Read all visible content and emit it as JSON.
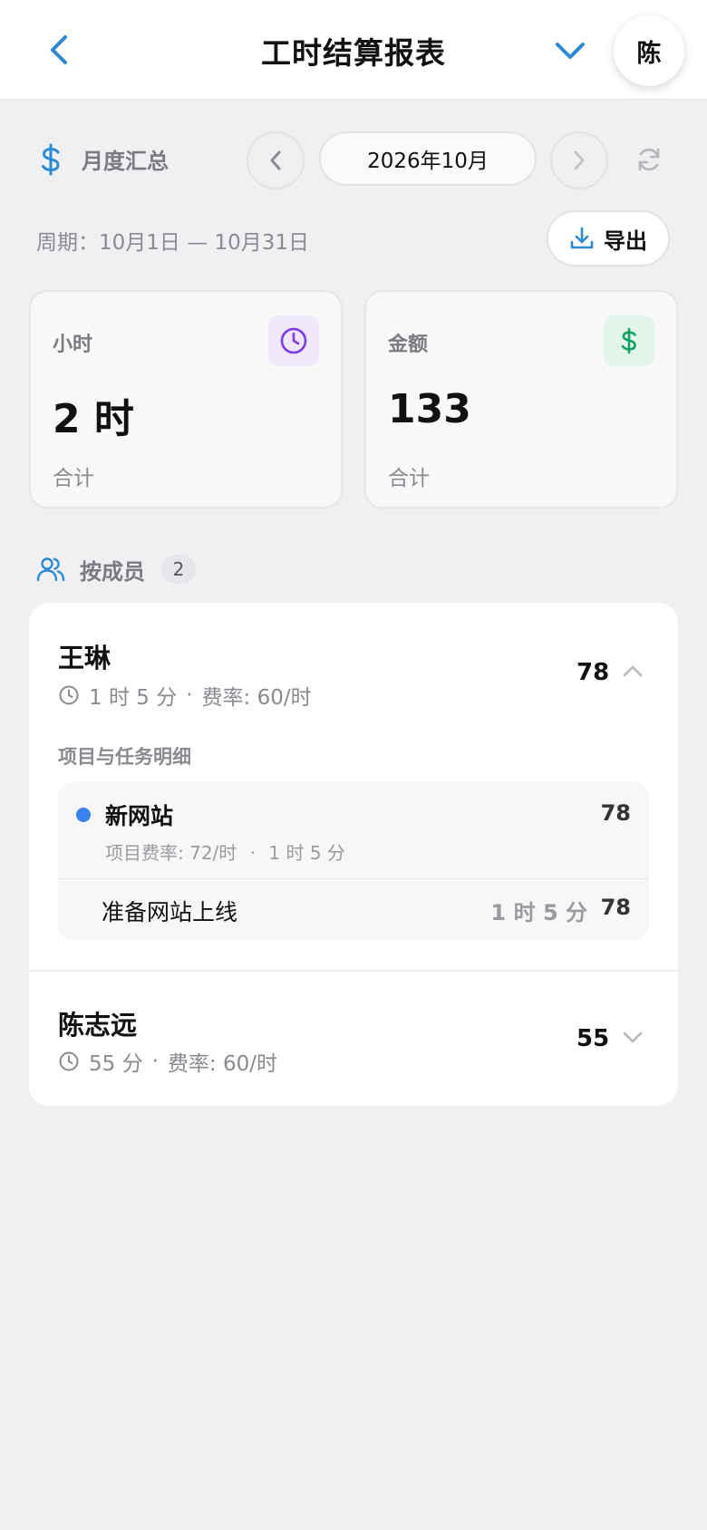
{
  "header": {
    "title": "工时结算报表",
    "avatar": "陈",
    "icons": {
      "back": "chevron-left-icon",
      "dropdown": "chevron-down-icon"
    }
  },
  "summary": {
    "label": "月度汇总",
    "icon": "dollar-icon",
    "month": "2026年10月",
    "period": "周期：10月1日 — 10月31日",
    "export_label": "导出"
  },
  "cards": {
    "hours": {
      "label": "小时",
      "value": "2 时",
      "sub": "合计",
      "icon": "clock-icon"
    },
    "amount": {
      "label": "金额",
      "value": "133",
      "sub": "合计",
      "icon": "dollar-icon"
    }
  },
  "members_section": {
    "label": "按成员",
    "count": "2"
  },
  "members": [
    {
      "name": "王琳",
      "time": "1 时 5 分",
      "dot": "·",
      "rate": "费率: 60/时",
      "amount": "78",
      "expanded": true,
      "detail_title": "项目与任务明细",
      "project": {
        "name": "新网站",
        "amount": "78",
        "rate": "项目费率: 72/时",
        "dot": "·",
        "time": "1 时 5 分",
        "task": {
          "name": "准备网站上线",
          "time": "1 时 5 分",
          "amount": "78"
        }
      }
    },
    {
      "name": "陈志远",
      "time": "55 分",
      "dot": "·",
      "rate": "费率: 60/时",
      "amount": "55",
      "expanded": false
    }
  ],
  "colors": {
    "accent": "#2b8ad6",
    "purple": "#7c3aed",
    "purple_bg": "#efe8fb",
    "green": "#13a060",
    "green_bg": "#e2f5ea",
    "project_dot": "#3a82f0"
  }
}
